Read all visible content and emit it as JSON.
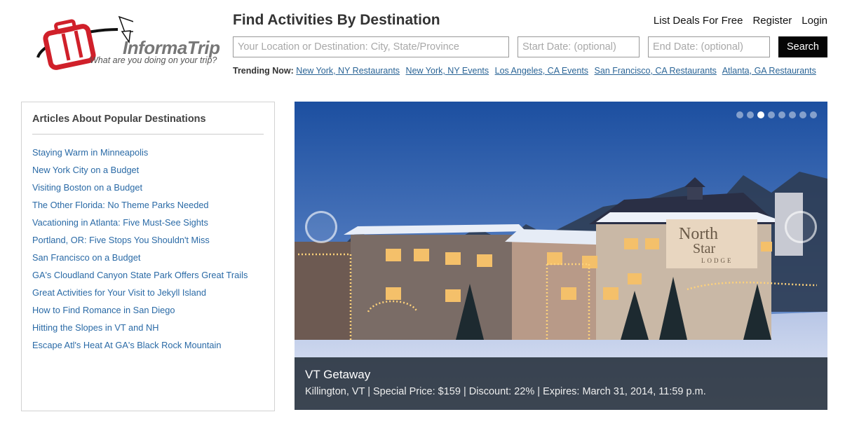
{
  "logo": {
    "brand": "InformaTrip",
    "tagline": "What are you doing on your trip?"
  },
  "header": {
    "title": "Find Activities By Destination",
    "links": [
      "List Deals For Free",
      "Register",
      "Login"
    ]
  },
  "search": {
    "destination_placeholder": "Your Location or Destination: City, State/Province",
    "start_placeholder": "Start Date: (optional)",
    "end_placeholder": "End Date: (optional)",
    "button_label": "Search"
  },
  "trending": {
    "label": "Trending Now:",
    "items": [
      "New York, NY Restaurants",
      "New York, NY Events",
      "Los Angeles, CA Events",
      "San Francisco, CA Restaurants",
      "Atlanta, GA Restaurants"
    ]
  },
  "sidebar": {
    "title": "Articles About Popular Destinations",
    "articles": [
      "Staying Warm in Minneapolis",
      "New York City on a Budget",
      "Visiting Boston on a Budget",
      "The Other Florida: No Theme Parks Needed",
      "Vacationing in Atlanta: Five Must-See Sights",
      "Portland, OR: Five Stops You Shouldn't Miss",
      "San Francisco on a Budget",
      "GA's Cloudland Canyon State Park Offers Great Trails",
      "Great Activities for Your Visit to Jekyll Island",
      "How to Find Romance in San Diego",
      "Hitting the Slopes in VT and NH",
      "Escape Atl's Heat At GA's Black Rock Mountain"
    ]
  },
  "slider": {
    "slide_count": 8,
    "active_slide": 3,
    "caption_title": "VT Getaway",
    "caption_details": "Killington, VT | Special Price: $159 | Discount: 22% | Expires: March 31, 2014, 11:59 p.m.",
    "sign_line1": "North",
    "sign_line2": "Star",
    "sign_line3": "LODGE"
  },
  "colors": {
    "link": "#2a6496",
    "search_button": "#050505",
    "logo_red": "#d0202a",
    "caption_bg": "#232d3a"
  }
}
